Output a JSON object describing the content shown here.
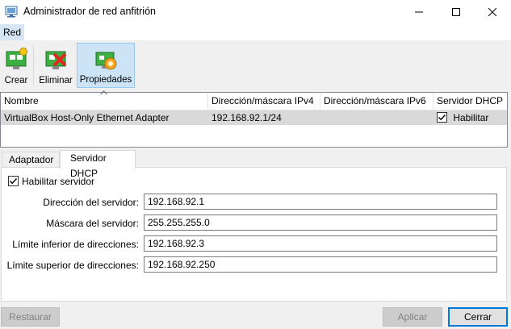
{
  "window": {
    "title": "Administrador de red anfitrión"
  },
  "menu": {
    "items": [
      "Red"
    ]
  },
  "toolbar": {
    "create_label": "Crear",
    "delete_label": "Eliminar",
    "properties_label": "Propiedades"
  },
  "list": {
    "columns": [
      "Nombre",
      "Dirección/máscara IPv4",
      "Dirección/máscara IPv6",
      "Servidor DHCP"
    ],
    "rows": [
      {
        "name": "VirtualBox Host-Only Ethernet Adapter",
        "ipv4": "192.168.92.1/24",
        "ipv6": "",
        "dhcp_label": "Habilitar",
        "dhcp_checked": true
      }
    ]
  },
  "tabs": [
    "Adaptador",
    "Servidor DHCP"
  ],
  "dhcp": {
    "enable_label": "Habilitar servidor",
    "enabled": true,
    "fields": [
      {
        "label": "Dirección del servidor:",
        "value": "192.168.92.1"
      },
      {
        "label": "Máscara del servidor:",
        "value": "255.255.255.0"
      },
      {
        "label": "Límite inferior de direcciones:",
        "value": "192.168.92.3"
      },
      {
        "label": "Límite superior de direcciones:",
        "value": "192.168.92.250"
      }
    ]
  },
  "buttons": {
    "reset": "Restaurar",
    "apply": "Aplicar",
    "close": "Cerrar"
  }
}
